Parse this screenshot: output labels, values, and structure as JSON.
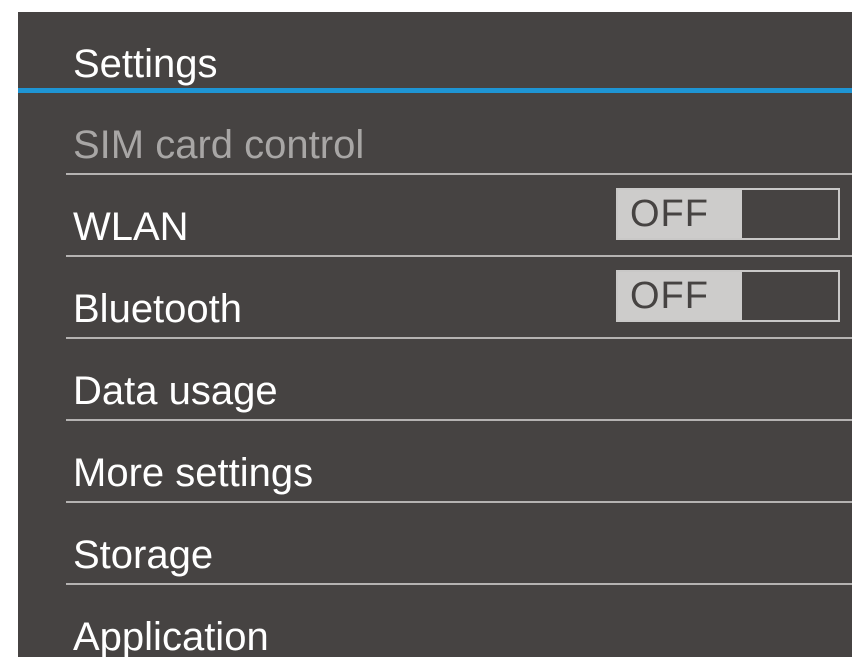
{
  "header": {
    "title": "Settings"
  },
  "items": [
    {
      "label": "SIM card control",
      "enabled": false
    },
    {
      "label": "WLAN",
      "toggle": "OFF"
    },
    {
      "label": "Bluetooth",
      "toggle": "OFF"
    },
    {
      "label": "Data usage"
    },
    {
      "label": "More settings"
    },
    {
      "label": "Storage"
    },
    {
      "label": "Application"
    }
  ],
  "colors": {
    "background": "#464342",
    "accent": "#1e95d4",
    "text": "#ffffff",
    "disabled_text": "#a8a6a5",
    "toggle_off_fill": "#cdcccb"
  }
}
